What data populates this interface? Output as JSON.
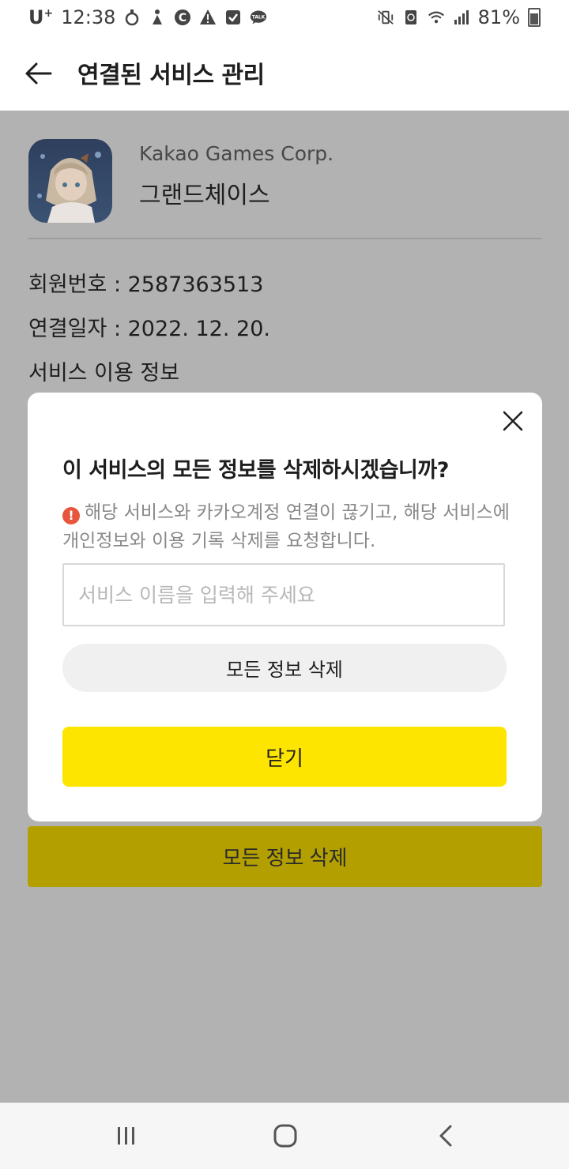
{
  "status_bar": {
    "carrier": "U",
    "carrier_sup": "+",
    "time": "12:38",
    "battery": "81%",
    "left_icons": [
      "timer-icon",
      "figure-icon",
      "c-icon",
      "warning-icon",
      "check-icon",
      "talk-icon"
    ],
    "right_icons": [
      "mute-vibrate-icon",
      "recycle-icon",
      "wifi-icon",
      "signal-icon",
      "battery-icon"
    ]
  },
  "header": {
    "title": "연결된 서비스 관리",
    "back_icon": "arrow-left-icon"
  },
  "service": {
    "company": "Kakao Games Corp.",
    "name": "그랜드체이스"
  },
  "info": {
    "member_no": "회원번호 : 2587363513",
    "connected_date": "연결일자 : 2022. 12. 20.",
    "usage_info": "서비스 이용 정보"
  },
  "background_delete_label": "모든 정보 삭제",
  "dialog": {
    "title": "이 서비스의 모든 정보를 삭제하시겠습니까?",
    "warning_icon_glyph": "!",
    "warning_text": "해당 서비스와 카카오계정 연결이 끊기고, 해당 서비스에 개인정보와 이용 기록 삭제를 요청합니다.",
    "input_placeholder": "서비스 이름을 입력해 주세요",
    "input_value": "",
    "delete_label": "모든 정보 삭제",
    "close_label": "닫기"
  },
  "colors": {
    "kakao_yellow": "#fee500",
    "dimmed_yellow": "#b3a000",
    "overlay": "#b2b2b2",
    "warning_red": "#e8553d"
  }
}
